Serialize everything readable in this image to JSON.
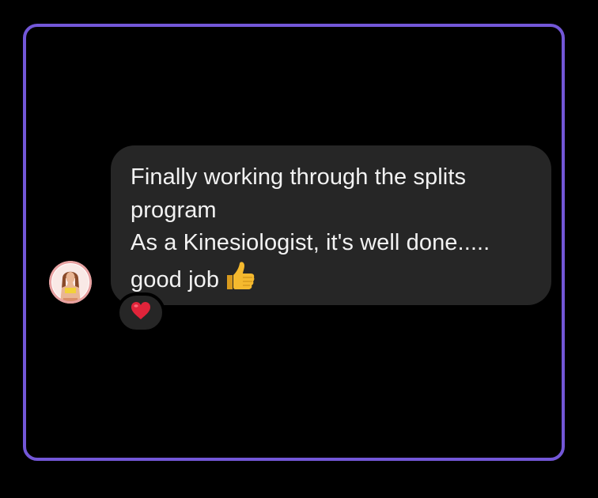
{
  "message": {
    "lines": [
      "Finally working through the splits",
      "program",
      "As a Kinesiologist, it's well done.....",
      "good job"
    ],
    "trailing_emoji": "thumbs-up"
  },
  "reaction": {
    "emoji": "red-heart"
  },
  "sender": {
    "avatar": "profile-photo"
  },
  "colors": {
    "frame_border": "#7357d8",
    "background": "#000000",
    "bubble": "#262626",
    "text": "#f2f2f2",
    "heart": "#e0243a",
    "thumb": "#f5b92e"
  }
}
